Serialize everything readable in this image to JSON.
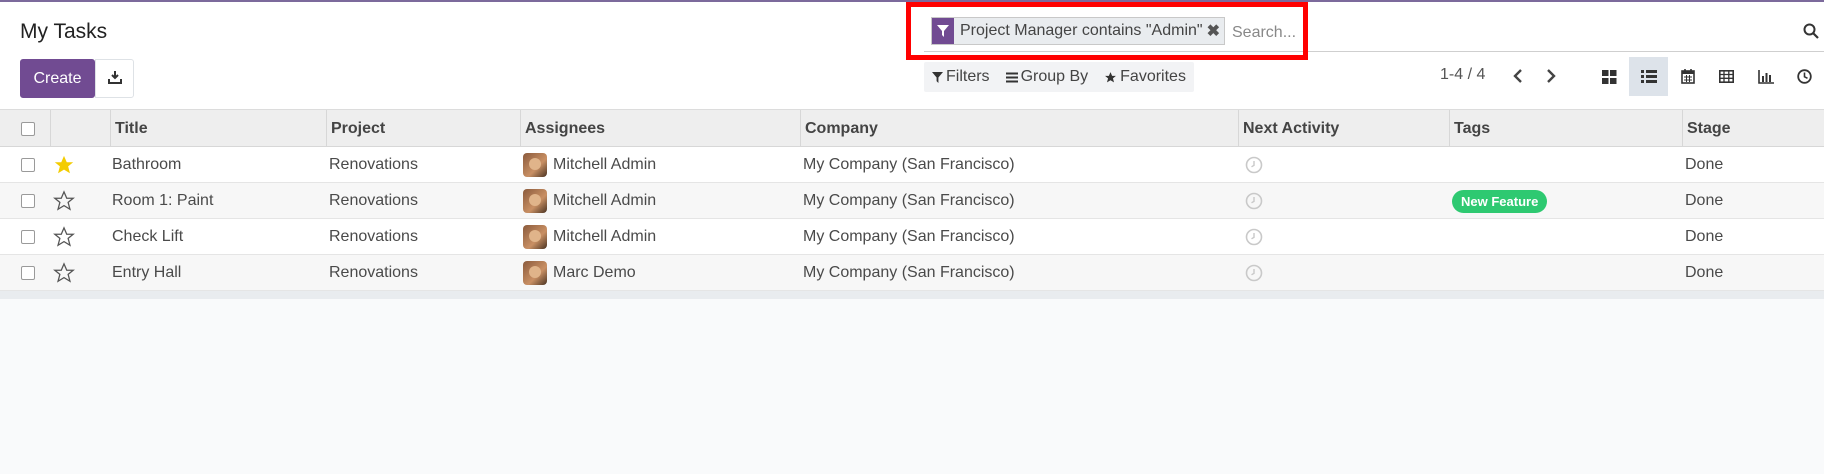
{
  "header": {
    "title": "My Tasks",
    "create_label": "Create",
    "download_icon": "download-icon"
  },
  "search": {
    "facet_icon": "filter-icon",
    "facet_label": "Project Manager contains \"Admin\"",
    "facet_remove": "✖",
    "placeholder": "Search...",
    "search_icon": "magnifier-icon"
  },
  "filter_bar": {
    "filters": "Filters",
    "group_by": "Group By",
    "favorites": "Favorites"
  },
  "pager": {
    "value": "1-4 / 4"
  },
  "views": [
    "kanban",
    "list",
    "calendar",
    "pivot",
    "graph",
    "activity"
  ],
  "colors": {
    "brand": "#714b92",
    "tag_green": "#2ec971",
    "star_yellow": "#f3cc00",
    "highlight": "#ff0000"
  },
  "table": {
    "columns": [
      "Title",
      "Project",
      "Assignees",
      "Company",
      "Next Activity",
      "Tags",
      "Stage"
    ],
    "rows": [
      {
        "starred": true,
        "title": "Bathroom",
        "project": "Renovations",
        "assignee": "Mitchell Admin",
        "company": "My Company (San Francisco)",
        "tag": "",
        "stage": "Done"
      },
      {
        "starred": false,
        "title": "Room 1: Paint",
        "project": "Renovations",
        "assignee": "Mitchell Admin",
        "company": "My Company (San Francisco)",
        "tag": "New Feature",
        "stage": "Done"
      },
      {
        "starred": false,
        "title": "Check Lift",
        "project": "Renovations",
        "assignee": "Mitchell Admin",
        "company": "My Company (San Francisco)",
        "tag": "",
        "stage": "Done"
      },
      {
        "starred": false,
        "title": "Entry Hall",
        "project": "Renovations",
        "assignee": "Marc Demo",
        "company": "My Company (San Francisco)",
        "tag": "",
        "stage": "Done"
      }
    ]
  }
}
